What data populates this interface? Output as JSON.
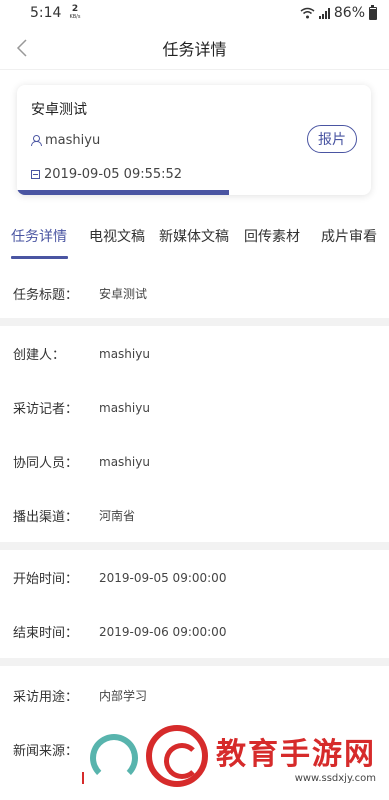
{
  "status_bar": {
    "time": "5:14",
    "net_speed_value": "2",
    "net_speed_unit": "KB/s",
    "battery": "86%"
  },
  "nav": {
    "back_icon": "chevron-left-icon",
    "title": "任务详情"
  },
  "task_card": {
    "title": "安卓测试",
    "user": "mashiyu",
    "time": "2019-09-05 09:55:52",
    "report_button": "报片",
    "progress": 0.6
  },
  "tabs": [
    {
      "label": "任务详情",
      "active": true
    },
    {
      "label": "电视文稿",
      "active": false
    },
    {
      "label": "新媒体文稿",
      "active": false
    },
    {
      "label": "回传素材",
      "active": false
    },
    {
      "label": "成片审看",
      "active": false
    }
  ],
  "details": {
    "task_title": {
      "label": "任务标题：",
      "value": "安卓测试"
    },
    "creator": {
      "label": "创建人：",
      "value": "mashiyu"
    },
    "reporter": {
      "label": "采访记者：",
      "value": "mashiyu"
    },
    "collaborator": {
      "label": "协同人员：",
      "value": "mashiyu"
    },
    "channel": {
      "label": "播出渠道：",
      "value": "河南省"
    },
    "start_time": {
      "label": "开始时间：",
      "value": "2019-09-05 09:00:00"
    },
    "end_time": {
      "label": "结束时间：",
      "value": "2019-09-06 09:00:00"
    },
    "purpose": {
      "label": "采访用途：",
      "value": "内部学习"
    },
    "news_source": {
      "label": "新闻来源："
    }
  },
  "watermark": {
    "text": "教育手游网",
    "url": "www.ssdxjy.com"
  },
  "colors": {
    "accent": "#4a55a2",
    "divider": "#f2f2f2",
    "watermark_red": "#d62b2b"
  }
}
